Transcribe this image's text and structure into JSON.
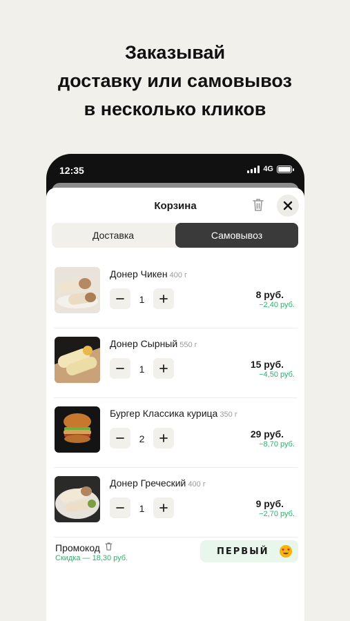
{
  "headline": [
    "Заказывай",
    "доставку или самовывоз",
    "в несколько кликов"
  ],
  "status_bar": {
    "time": "12:35",
    "network": "4G"
  },
  "cart": {
    "title": "Корзина",
    "tabs": [
      {
        "label": "Доставка",
        "selected": false
      },
      {
        "label": "Самовывоз",
        "selected": true
      }
    ],
    "items": [
      {
        "name": "Донер Чикен",
        "weight": "400 г",
        "qty": "1",
        "price": "8 руб.",
        "discount": "−2,40 руб."
      },
      {
        "name": "Донер Сырный",
        "weight": "550 г",
        "qty": "1",
        "price": "15 руб.",
        "discount": "−4,50 руб."
      },
      {
        "name": "Бургер Классика курица",
        "weight": "350 г",
        "qty": "2",
        "price": "29 руб.",
        "discount": "−8,70 руб."
      },
      {
        "name": "Донер Греческий",
        "weight": "400 г",
        "qty": "1",
        "price": "9 руб.",
        "discount": "−2,70 руб."
      }
    ],
    "promo": {
      "label": "Промокод",
      "discount": "Скидка — 18,30 руб.",
      "code": "ПЕРВЫЙ"
    }
  },
  "colors": {
    "accent_green": "#26b36b",
    "selected_tab": "#3a3a3a",
    "background": "#f2f0eb"
  }
}
